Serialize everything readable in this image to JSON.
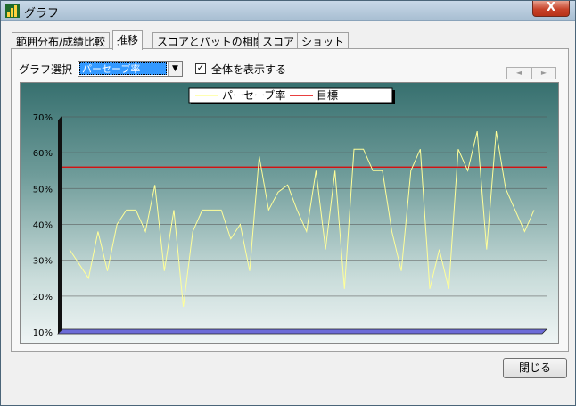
{
  "window": {
    "title": "グラフ",
    "close_glyph": "X"
  },
  "tabs": [
    {
      "label": "範囲分布/成績比較",
      "active": false
    },
    {
      "label": "推移",
      "active": true
    },
    {
      "label": "スコアとパットの相関",
      "active": false
    },
    {
      "label": "スコア",
      "active": false
    },
    {
      "label": "ショット",
      "active": false
    }
  ],
  "controls": {
    "graph_select_label": "グラフ選択",
    "graph_select_value": "パーセーブ率",
    "show_all_label": "全体を表示する",
    "show_all_checked": true,
    "scroll_left_glyph": "◄",
    "scroll_right_glyph": "►"
  },
  "footer": {
    "close_label": "閉じる"
  },
  "colors": {
    "series_line": "#ffff99",
    "target_line": "#e00000",
    "floor": "#6c6cd8"
  },
  "chart_data": {
    "type": "line",
    "ylim": [
      10,
      70
    ],
    "yticks": [
      "70%",
      "60%",
      "50%",
      "40%",
      "30%",
      "20%",
      "10%"
    ],
    "target": {
      "name": "目標",
      "value": 56
    },
    "series": [
      {
        "name": "パーセーブ率",
        "values": [
          33,
          29,
          25,
          38,
          27,
          40,
          44,
          44,
          38,
          51,
          27,
          44,
          17,
          38,
          44,
          44,
          44,
          36,
          40,
          27,
          59,
          44,
          49,
          51,
          44,
          38,
          55,
          33,
          55,
          22,
          61,
          61,
          55,
          55,
          38,
          27,
          55,
          61,
          22,
          33,
          22,
          61,
          55,
          66,
          33,
          66,
          50,
          44,
          38,
          44
        ]
      }
    ]
  }
}
